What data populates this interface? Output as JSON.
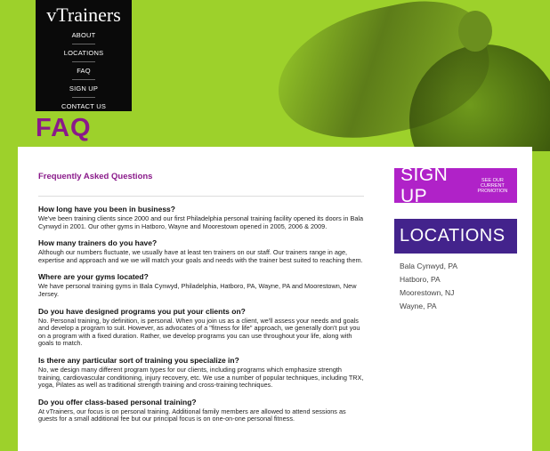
{
  "logo": "vTrainers",
  "nav": [
    "ABOUT",
    "LOCATIONS",
    "FAQ",
    "SIGN UP",
    "CONTACT US"
  ],
  "page_title": "FAQ",
  "faq_heading": "Frequently Asked Questions",
  "faqs": [
    {
      "q": "How long have you been in business?",
      "a": "We've been training clients since 2000 and our first Philadelphia personal training facility opened its doors in Bala Cynwyd in 2001. Our other gyms in Hatboro, Wayne and Moorestown opened in 2005, 2006 & 2009."
    },
    {
      "q": "How many trainers do you have?",
      "a": "Although our numbers fluctuate, we usually have at least ten trainers on our staff. Our trainers range in age, expertise and approach and we we will match your goals and needs with the trainer best suited to reaching them."
    },
    {
      "q": "Where are your gyms located?",
      "a": "We have personal training gyms in Bala Cynwyd, Philadelphia, Hatboro, PA, Wayne, PA and Moorestown, New Jersey."
    },
    {
      "q": "Do you have designed programs you put your clients on?",
      "a": "No. Personal training, by definition, is personal. When you join us as a client, we'll assess your needs and goals and develop a program to suit. However, as advocates of a \"fitness for life\" approach, we generally don't put you on a program with a fixed duration. Rather, we develop programs you can use throughout your life, along with goals to match."
    },
    {
      "q": "Is there any particular sort of training you specialize in?",
      "a": "No, we design many different program types for our clients, including programs which emphasize strength training, cardiovascular conditioning, injury recovery, etc. We use a number of popular techniques, including TRX, yoga, Pilates as well as traditional strength training and cross-training techniques."
    },
    {
      "q": "Do you offer class-based personal training?",
      "a": "At vTrainers, our focus is on personal training. Additional family members are allowed to attend sessions as guests for a small additional fee but our principal focus is on one-on-one personal fitness."
    }
  ],
  "signup": {
    "label": "SIGN UP",
    "promo": "SEE OUR CURRENT PROMOTION"
  },
  "locations": {
    "label": "LOCATIONS",
    "items": [
      "Bala Cynwyd, PA",
      "Hatboro, PA",
      "Moorestown, NJ",
      "Wayne, PA"
    ]
  },
  "colors": {
    "background": "#9dd12b",
    "purple": "#b022c8",
    "navy": "#43238c",
    "title": "#8a1a8a"
  }
}
